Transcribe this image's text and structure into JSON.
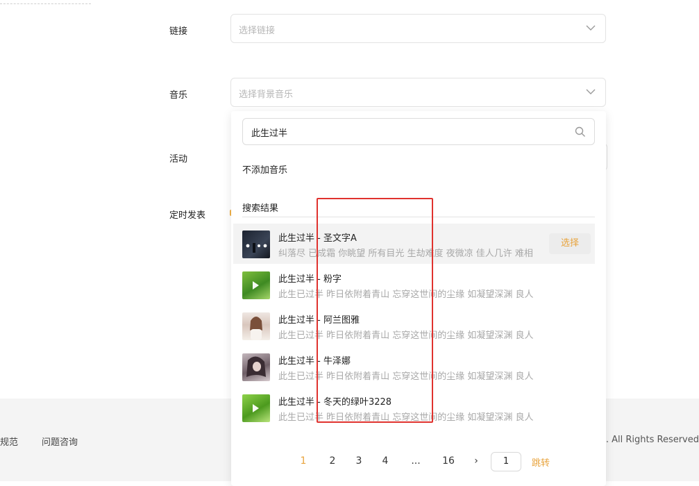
{
  "form": {
    "link_label": "链接",
    "link_placeholder": "选择链接",
    "music_label": "音乐",
    "music_placeholder": "选择背景音乐",
    "activity_label": "活动",
    "schedule_label": "定时发表"
  },
  "dropdown": {
    "search_value": "此生过半",
    "no_music": "不添加音乐",
    "results_title": "搜索结果",
    "select_label": "选择",
    "songs": [
      {
        "title": "此生过半 - 圣文字A",
        "lyric": "纠落尽 已成霜 你眺望 所有目光 生劫难度 夜微凉 佳人几许 难相",
        "cover": "night-lights"
      },
      {
        "title": "此生过半 - 粉字",
        "lyric": "此生已过半 昨日依附着青山 忘穿这世间的尘缘 如凝望深渊 良人",
        "cover": "green-leaf"
      },
      {
        "title": "此生过半 - 阿兰图雅",
        "lyric": "此生已过半 昨日依附着青山 忘穿这世间的尘缘 如凝望深渊 良人",
        "cover": "portrait-light"
      },
      {
        "title": "此生过半 - 牛泽娜",
        "lyric": "此生已过半 昨日依附着青山 忘穿这世间的尘缘 如凝望深渊 良人",
        "cover": "portrait-dark"
      },
      {
        "title": "此生过半 - 冬天的绿叶3228",
        "lyric": "此生已过半 昨日依附着青山 忘穿这世间的尘缘 如凝望深渊 良人",
        "cover": "green-leaf"
      }
    ]
  },
  "pagination": {
    "pages": [
      "1",
      "2",
      "3",
      "4",
      "...",
      "16"
    ],
    "next": "›",
    "input_value": "1",
    "jump_label": "跳转",
    "current": "1"
  },
  "footer": {
    "link_partial": "规范",
    "help_link": "问题咨询",
    "copyright_partial": "nc. All Rights Reserved"
  },
  "colors": {
    "accent": "#e8a33c",
    "annotation": "#e0322e",
    "footer_bg": "#f4f4f4"
  }
}
